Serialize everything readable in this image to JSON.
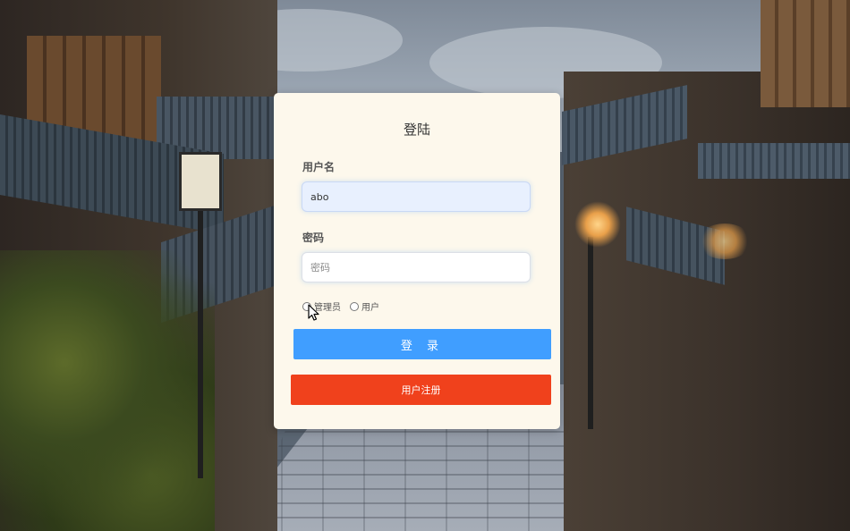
{
  "login_form": {
    "title": "登陆",
    "username": {
      "label": "用户名",
      "value": "abo"
    },
    "password": {
      "label": "密码",
      "placeholder": "密码"
    },
    "roles": [
      "管理员",
      "用户"
    ],
    "login_button": "登 录",
    "register_button": "用户注册"
  },
  "colors": {
    "card_background": "#fdf8ec",
    "login_button": "#409eff",
    "register_button": "#f0411c"
  },
  "icons": {
    "cursor": "mouse-pointer-icon"
  }
}
